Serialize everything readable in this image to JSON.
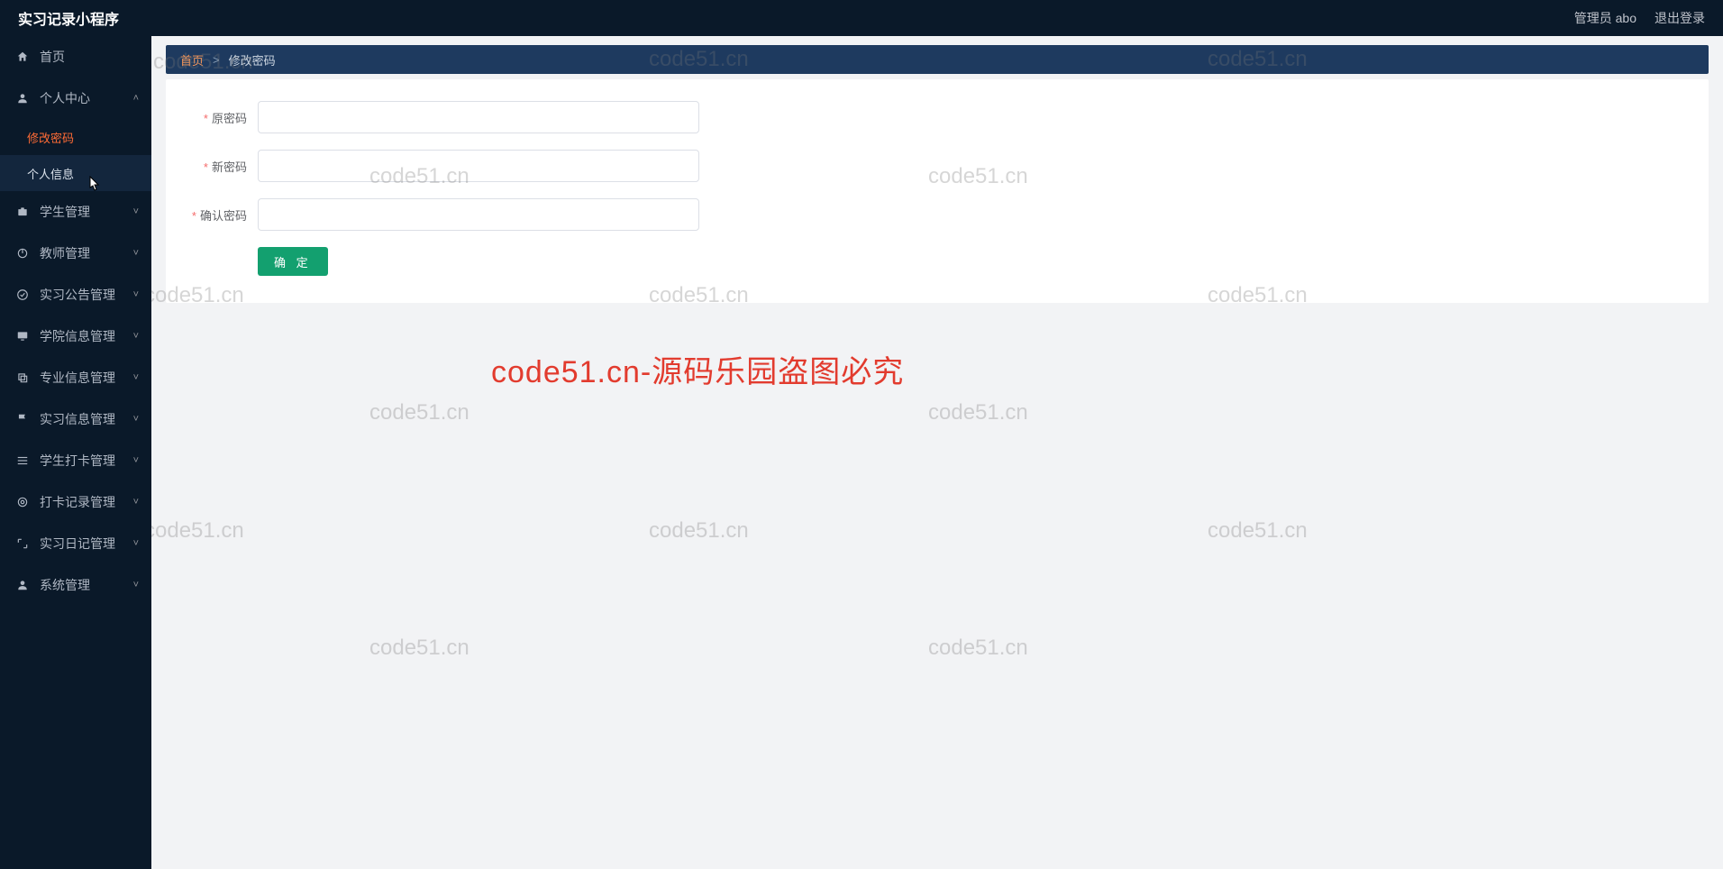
{
  "header": {
    "title": "实习记录小程序",
    "user_label": "管理员 abo",
    "logout": "退出登录"
  },
  "sidebar": {
    "home": "首页",
    "personal_center": "个人中心",
    "change_password": "修改密码",
    "personal_info": "个人信息",
    "student_mgmt": "学生管理",
    "teacher_mgmt": "教师管理",
    "announce_mgmt": "实习公告管理",
    "college_mgmt": "学院信息管理",
    "major_mgmt": "专业信息管理",
    "intern_info_mgmt": "实习信息管理",
    "checkin_mgmt": "学生打卡管理",
    "checkin_record_mgmt": "打卡记录管理",
    "diary_mgmt": "实习日记管理",
    "system_mgmt": "系统管理"
  },
  "breadcrumb": {
    "home": "首页",
    "sep": ">",
    "current": "修改密码"
  },
  "form": {
    "old_pwd": "原密码",
    "new_pwd": "新密码",
    "confirm_pwd": "确认密码",
    "submit": "确 定"
  },
  "watermark": {
    "text": "code51.cn",
    "main": "code51.cn-源码乐园盗图必究"
  }
}
